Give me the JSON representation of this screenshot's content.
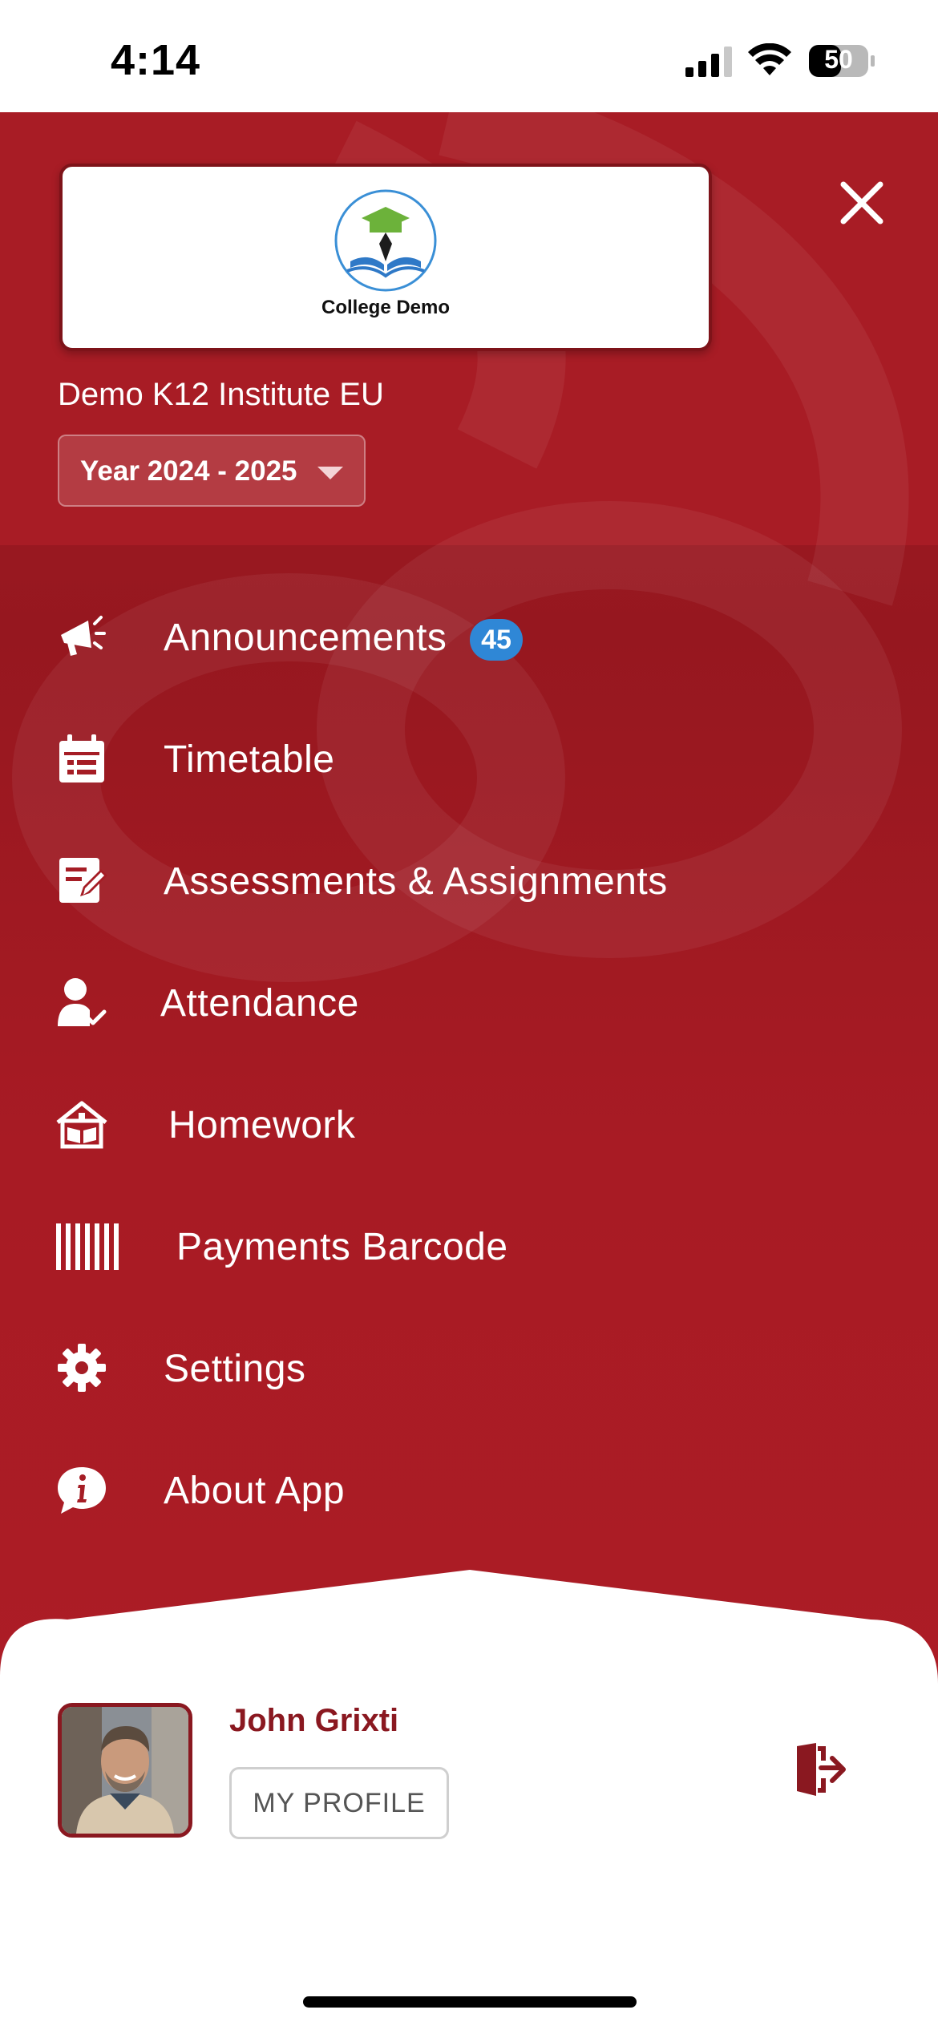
{
  "status_bar": {
    "time": "4:14",
    "battery": "50"
  },
  "drawer": {
    "logo_text": "College Demo",
    "institute": "Demo K12 Institute EU",
    "year_select": {
      "value": "Year 2024 - 2025"
    },
    "menu": [
      {
        "label": "Announcements",
        "icon": "megaphone-icon",
        "badge": "45"
      },
      {
        "label": "Timetable",
        "icon": "calendar-icon"
      },
      {
        "label": "Assessments & Assignments",
        "icon": "edit-document-icon"
      },
      {
        "label": "Attendance",
        "icon": "person-check-icon"
      },
      {
        "label": "Homework",
        "icon": "school-house-icon"
      },
      {
        "label": "Payments Barcode",
        "icon": "barcode-icon"
      },
      {
        "label": "Settings",
        "icon": "gear-icon"
      },
      {
        "label": "About App",
        "icon": "info-chat-icon"
      }
    ]
  },
  "profile": {
    "name": "John Grixti",
    "button_label": "MY PROFILE"
  },
  "colors": {
    "primary": "#a51d25",
    "badge": "#2f87d6",
    "name": "#8a1820"
  }
}
